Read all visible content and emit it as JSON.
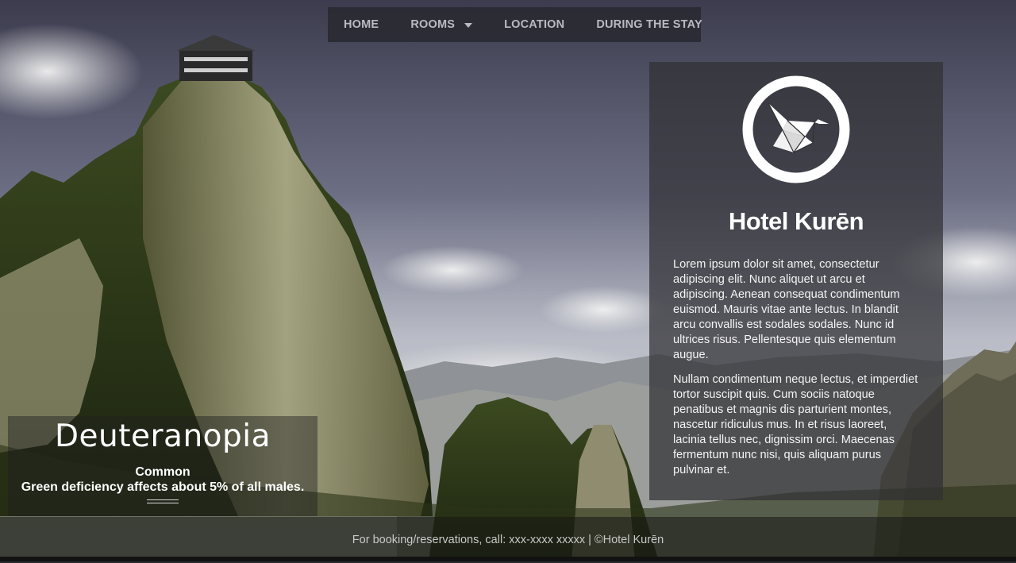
{
  "nav": {
    "items": [
      {
        "label": "HOME"
      },
      {
        "label": "ROOMS",
        "has_dropdown": true
      },
      {
        "label": "LOCATION"
      },
      {
        "label": "DURING THE STAY"
      }
    ]
  },
  "panel": {
    "logo_icon": "origami-crane-icon",
    "hotel_name": "Hotel Kurēn",
    "paragraphs": [
      "Lorem ipsum dolor sit amet, consectetur adipiscing elit. Nunc aliquet ut arcu et adipiscing. Aenean consequat condimentum euismod. Mauris vitae ante lectus. In blandit arcu convallis est sodales sodales. Nunc id ultrices risus. Pellentesque quis elementum augue.",
      "Nullam condimentum neque lectus, et imperdiet tortor suscipit quis. Cum sociis natoque penatibus et magnis dis parturient montes, nascetur ridiculus mus. In et risus laoreet, lacinia tellus nec, dignissim orci. Maecenas fermentum nunc nisi, quis aliquam purus pulvinar et."
    ]
  },
  "caption": {
    "title": "Deuteranopia",
    "subtitle": "Common",
    "description": "Green deficiency affects about 5% of all males."
  },
  "footer": {
    "text": "For booking/reservations, call: xxx-xxxx xxxxx | ©Hotel Kurēn"
  },
  "colors": {
    "nav_bg": "#282930",
    "nav_text": "#b9bac3",
    "panel_bg": "#303034",
    "accent_white": "#ffffff"
  }
}
